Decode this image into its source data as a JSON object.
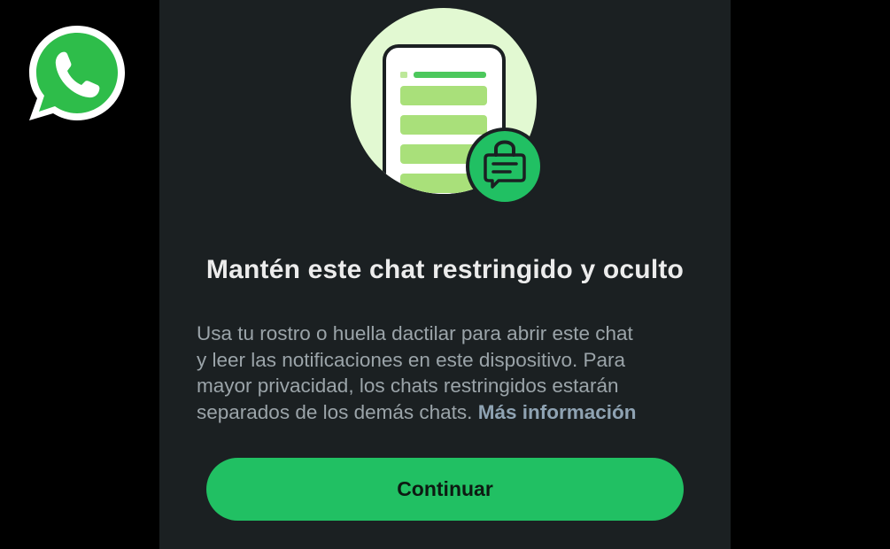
{
  "app": {
    "logo_icon": "whatsapp-logo-icon",
    "brand_color": "#25d366"
  },
  "illustration": {
    "icon": "locked-chat-icon",
    "badge_icon": "lock-chat-bubble-icon"
  },
  "dialog": {
    "title": "Mantén este chat restringido y oculto",
    "description_lines": [
      "Usa tu rostro o huella dactilar para abrir este chat",
      "y leer las notificaciones en este dispositivo. Para",
      "mayor privacidad, los chats restringidos estarán",
      "separados de los demás chats."
    ],
    "more_info_link": "Más información",
    "continue_button": "Continuar"
  },
  "colors": {
    "background": "#1b2022",
    "accent": "#21c063",
    "title_text": "#ececec",
    "body_text": "#9ba4a9",
    "link_text": "#8fa3b3"
  }
}
